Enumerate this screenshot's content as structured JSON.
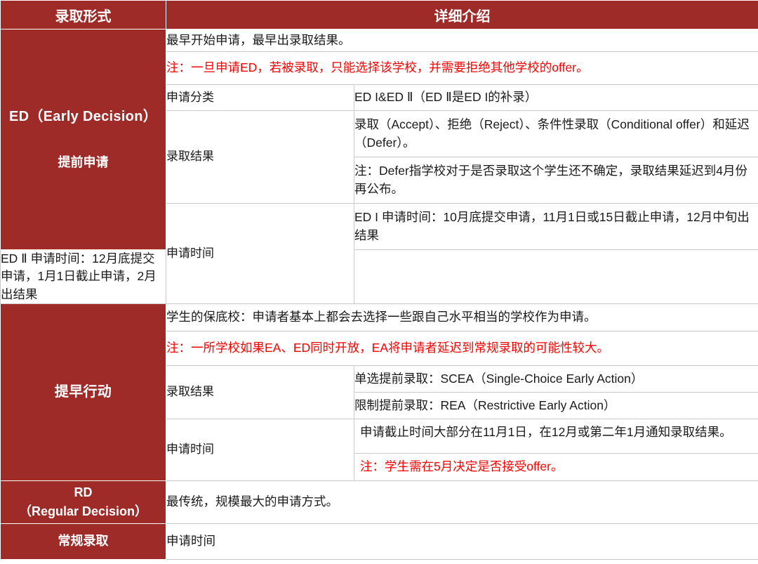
{
  "header": {
    "col_type": "录取形式",
    "col_detail": "详细介绍"
  },
  "colors": {
    "brand_red": "#9E2B28",
    "note_red": "#FF0000",
    "border": "#c9c9c9",
    "text": "#1a1a1a",
    "white": "#ffffff"
  },
  "sections": {
    "ed": {
      "title_en": "ED（Early Decision）",
      "title_zh": "提前申请",
      "intro": "最早开始申请，最早出录取结果。",
      "intro_note": "注：一旦申请ED，若被录取，只能选择该学校，并需要拒绝其他学校的offer。",
      "label_category": "申请分类",
      "value_category": "ED I&ED Ⅱ（ED Ⅱ是ED I的补录）",
      "label_result": "录取结果",
      "result_line1": "录取（Accept）、拒绝（Reject）、条件性录取（Conditional offer）和延迟（Defer）。",
      "result_note": "注：Defer指学校对于是否录取这个学生还不确定，录取结果延迟到4月份再公布。",
      "label_time": "申请时间",
      "time_ed1": "ED I 申请时间：10月底提交申请，11月1日或15日截止申请，12月中旬出结果",
      "time_ed2": "ED Ⅱ 申请时间：12月底提交申请，1月1日截止申请，2月出结果"
    },
    "ea": {
      "title_zh": "提早行动",
      "intro": "学生的保底校：申请者基本上都会去选择一些跟自己水平相当的学校作为申请。",
      "intro_note": "注：一所学校如果EA、ED同时开放，EA将申请者延迟到常规录取的可能性较大。",
      "label_result": "录取结果",
      "result_scea": "单选提前录取：SCEA（Single-Choice Early Action）",
      "result_rea": "限制提前录取：REA（Restrictive Early Action）",
      "label_time": "申请时间",
      "time_main": "申请截止时间大部分在11月1日，在12月或第二年1月通知录取结果。",
      "time_note": "注：学生需在5月决定是否接受offer。"
    },
    "rd": {
      "title_en_line1": "RD",
      "title_en_line2": "（Regular Decision）",
      "title_zh": "常规录取",
      "intro": "最传统，规模最大的申请方式。",
      "label_time": "申请时间"
    }
  }
}
